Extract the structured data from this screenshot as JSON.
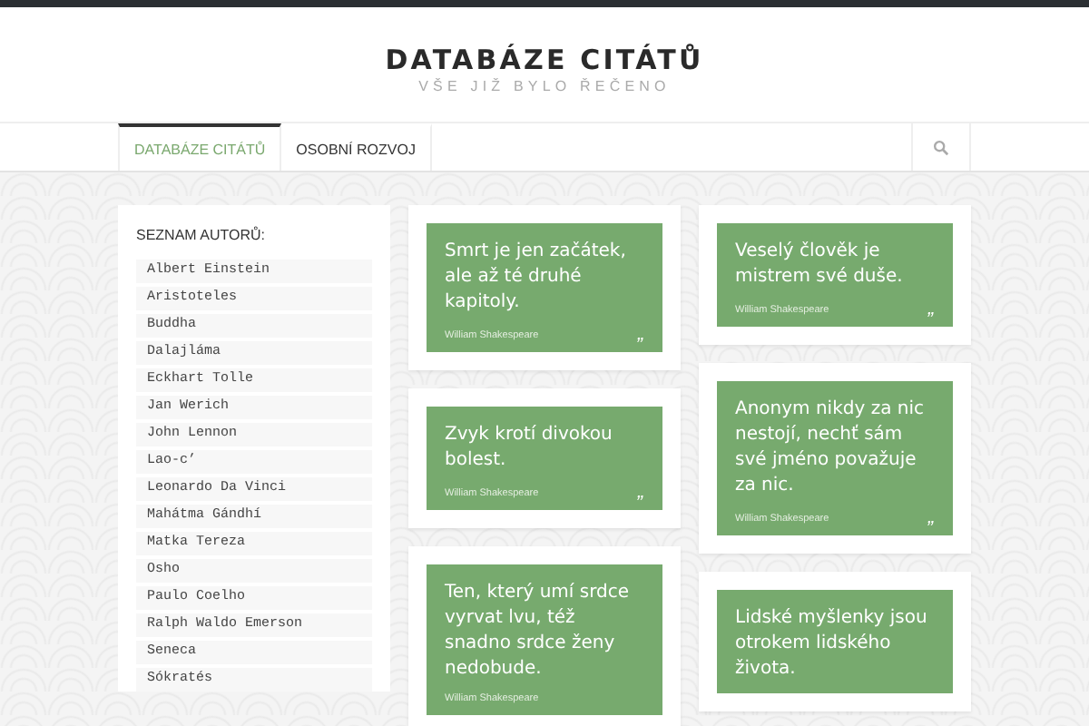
{
  "header": {
    "title": "DATABÁZE CITÁTŮ",
    "subtitle": "VŠE JIŽ BYLO ŘEČENO"
  },
  "nav": {
    "items": [
      {
        "label": "DATABÁZE CITÁTŮ",
        "selected": true
      },
      {
        "label": "OSOBNÍ ROZVOJ",
        "selected": false
      }
    ]
  },
  "sidebar": {
    "heading": "SEZNAM AUTORŮ:",
    "authors": [
      "Albert Einstein",
      "Aristoteles",
      "Buddha",
      "Dalajláma",
      "Eckhart Tolle",
      "Jan Werich",
      "John Lennon",
      "Lao-c’",
      "Leonardo Da Vinci",
      "Mahátma Gándhí",
      "Matka Tereza",
      "Osho",
      "Paulo Coelho",
      "Ralph Waldo Emerson",
      "Seneca",
      "Sókratés"
    ]
  },
  "columns": [
    [
      {
        "text": "Smrt je jen začátek, ale až té druhé kapitoly.",
        "author": "William Shakespeare",
        "mark": "„"
      },
      {
        "text": "Zvyk krotí divokou bolest.",
        "author": "William Shakespeare",
        "mark": "„"
      },
      {
        "text": "Ten, který umí srdce vyrvat lvu, též snadno srdce ženy nedobude.",
        "author": "William Shakespeare"
      }
    ],
    [
      {
        "text": "Veselý člověk je mistrem své duše.",
        "author": "William Shakespeare",
        "mark": "„"
      },
      {
        "text": "Anonym nikdy za nic nestojí, nechť sám své jméno považuje za nic.",
        "author": "William Shakespeare",
        "mark": "„"
      },
      {
        "text": "Lidské myšlenky jsou otrokem lidského života."
      }
    ]
  ]
}
